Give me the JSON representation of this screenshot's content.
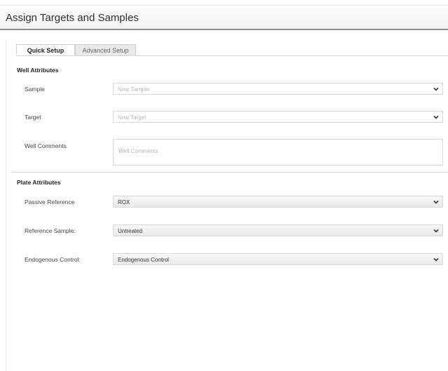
{
  "header": {
    "title": "Assign Targets and Samples"
  },
  "tabs": [
    {
      "label": "Quick Setup"
    },
    {
      "label": "Advanced Setup"
    }
  ],
  "well_attributes": {
    "title": "Well Attributes",
    "sample": {
      "label": "Sample",
      "placeholder": "New Sample"
    },
    "target": {
      "label": "Target",
      "placeholder": "New Target"
    },
    "comments": {
      "label": "Well Comments",
      "placeholder": "Well Comments"
    }
  },
  "plate_attributes": {
    "title": "Plate Attributes",
    "passive_reference": {
      "label": "Passive Reference",
      "value": "ROX"
    },
    "reference_sample": {
      "label": "Reference Sample:",
      "value": "Untreated"
    },
    "endogenous_control": {
      "label": "Endogenous Control:",
      "value": "Endogenous Control"
    }
  },
  "icons": {
    "dropdown": "chevron-down-icon"
  }
}
